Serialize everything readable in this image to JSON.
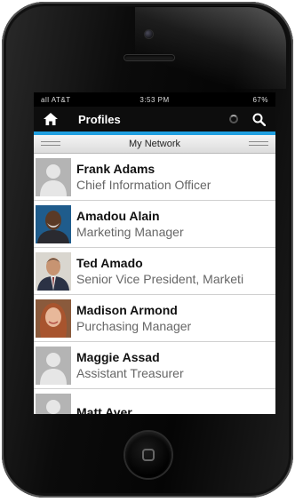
{
  "statusbar": {
    "carrier": "all AT&T",
    "time": "3:53 PM",
    "battery": "67%"
  },
  "appbar": {
    "title": "Profiles",
    "home_icon": "home-icon",
    "search_icon": "search-icon"
  },
  "network_bar": {
    "label": "My Network"
  },
  "profiles": [
    {
      "name": "Frank Adams",
      "title": "Chief Information Officer",
      "avatar": "placeholder"
    },
    {
      "name": "Amadou Alain",
      "title": "Marketing Manager",
      "avatar": "photo"
    },
    {
      "name": "Ted Amado",
      "title": "Senior Vice President, Marketi",
      "avatar": "photo"
    },
    {
      "name": "Madison Armond",
      "title": "Purchasing Manager",
      "avatar": "photo"
    },
    {
      "name": "Maggie Assad",
      "title": "Assistant Treasurer",
      "avatar": "placeholder"
    },
    {
      "name": "Matt Ayer",
      "title": "",
      "avatar": "placeholder"
    }
  ],
  "colors": {
    "accent": "#1f9fe0",
    "appbar": "#0d0d0d"
  }
}
